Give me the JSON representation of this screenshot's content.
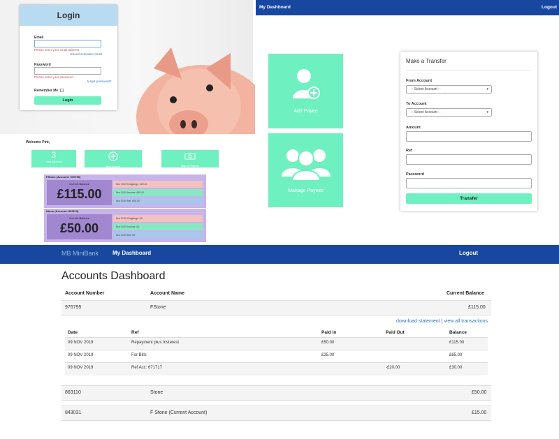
{
  "login": {
    "title": "Login",
    "email_label": "Email",
    "email_error": "Please enter your email address",
    "resend_link": "resend activation email",
    "password_label": "Password",
    "password_error": "Please enter your password",
    "forgot_link": "forgot password?",
    "remember_label": "Remember Me",
    "button": "Login"
  },
  "mini_dashboard": {
    "welcome": "Welcome Pint,",
    "tiles": [
      {
        "value": "3",
        "label": "View Accounts"
      },
      {
        "value": "",
        "label": "New Account"
      },
      {
        "value": "",
        "label": "Make a Payment"
      }
    ],
    "accounts": [
      {
        "title": "FStone (Account: 976795)",
        "balance_caption": "Current Balance",
        "balance": "£115.00",
        "rows": [
          "Nov 2019 Outgoings: £20.00",
          "Nov 2019 Income: £85.00",
          "Nov 2019 Net: £65.00"
        ]
      },
      {
        "title": "Stone (Account: 863110)",
        "balance_caption": "Current Balance",
        "balance": "£50.00",
        "rows": [
          "Nov 2019 Outgoings: £0",
          "Nov 2019 Income: £0",
          "Nov 2019 Net: £0"
        ]
      }
    ]
  },
  "top_panel": {
    "brand": "My Dashboard",
    "logout": "Logout",
    "tiles": [
      {
        "label": "Add Payee"
      },
      {
        "label": "Manage Payees"
      }
    ],
    "transfer": {
      "title": "Make a Transfer",
      "from_label": "From Account",
      "from_placeholder": "-- Select Account --",
      "to_label": "To Account",
      "to_placeholder": "-- Select Account --",
      "amount_label": "Amount",
      "ref_label": "Ref",
      "password_label": "Password",
      "button": "Transfer"
    }
  },
  "dashboard": {
    "brand": "MB MiniBank",
    "nav_active": "My Dashboard",
    "logout": "Logout",
    "title": "Accounts Dashboard",
    "columns": [
      "Account Number",
      "Account Name",
      "Current Balance"
    ],
    "accounts": [
      {
        "number": "976795",
        "name": "FStone",
        "balance": "£115.00"
      },
      {
        "number": "863110",
        "name": "Stone",
        "balance": "£50.00"
      },
      {
        "number": "843031",
        "name": "F Stone (Current Account)",
        "balance": "£15.00"
      }
    ],
    "download_link": "download statement",
    "separator": "|",
    "view_all_link": "view all transactions",
    "tx_columns": [
      "Date",
      "Ref",
      "Paid In",
      "Paid Out",
      "Balance"
    ],
    "transactions": [
      {
        "date": "09 NOV 2019",
        "ref": "Repayment plus Insterest",
        "paid_in": "£50.00",
        "paid_out": "",
        "balance": "£115.00"
      },
      {
        "date": "09 NOV 2019",
        "ref": "For Bills",
        "paid_in": "£35.00",
        "paid_out": "",
        "balance": "£65.00"
      },
      {
        "date": "09 NOV 2019",
        "ref": "Ref Acc: 671717",
        "paid_in": "",
        "paid_out": "-£20.00",
        "balance": "£30.00"
      }
    ]
  },
  "colors": {
    "navy": "#17479e",
    "mint": "#6ff0c0",
    "purple_box": "#c7b4e8",
    "purple_balance": "#a186d0",
    "pink_row": "#f3c1c1",
    "green_row": "#89e8c4",
    "blue_row": "#a9c6ec",
    "login_header": "#b9dbf2",
    "link_blue": "#2a7ac2",
    "error_red": "#d9534f"
  }
}
